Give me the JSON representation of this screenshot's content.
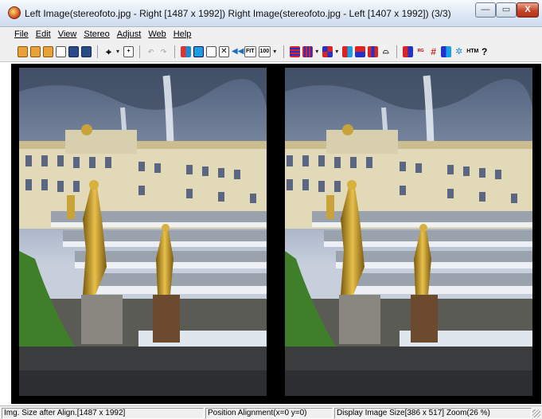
{
  "window": {
    "title": "Left Image(stereofoto.jpg - Right [1487 x 1992]) Right Image(stereofoto.jpg - Left [1407 x 1992])  (3/3)",
    "minimize_label": "—",
    "maximize_label": "▭",
    "close_label": "X"
  },
  "menu": {
    "items": [
      "File",
      "Edit",
      "View",
      "Stereo",
      "Adjust",
      "Web",
      "Help"
    ]
  },
  "toolbar": {
    "fit_label": "FIT",
    "zoom100_label": "100",
    "help_label": "?"
  },
  "status": {
    "image_size": "Img. Size after Align.[1487 x 1992]",
    "position_alignment": "Position Alignment(x=0 y=0)",
    "display_size": "Display Image Size[386 x 517]  Zoom(26 %)"
  }
}
